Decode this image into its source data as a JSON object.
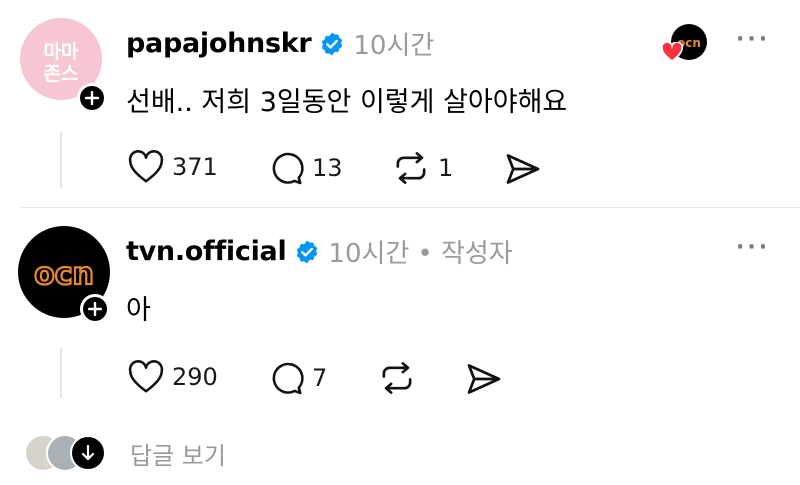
{
  "posts": [
    {
      "username": "papajohnskr",
      "time": "10시간",
      "author_tag": "",
      "text": "선배.. 저희 3일동안 이렇게 살아야해요",
      "avatar_label_top": "마마",
      "avatar_label_bottom": "존스",
      "likes": "371",
      "replies": "13",
      "reposts": "1",
      "more": "···"
    },
    {
      "username": "tvn.official",
      "time": "10시간",
      "author_tag": "• 작성자",
      "text": "아",
      "avatar_label": "ocn",
      "likes": "290",
      "replies": "7",
      "reposts": "",
      "more": "···"
    }
  ],
  "liked_by_badge": "ocn",
  "view_replies": "답글 보기",
  "colors": {
    "verified": "#0095f6",
    "avatar_pink": "#f6c6d2",
    "ocn_orange": "#e8892a",
    "meta_gray": "#9a9a9a"
  }
}
